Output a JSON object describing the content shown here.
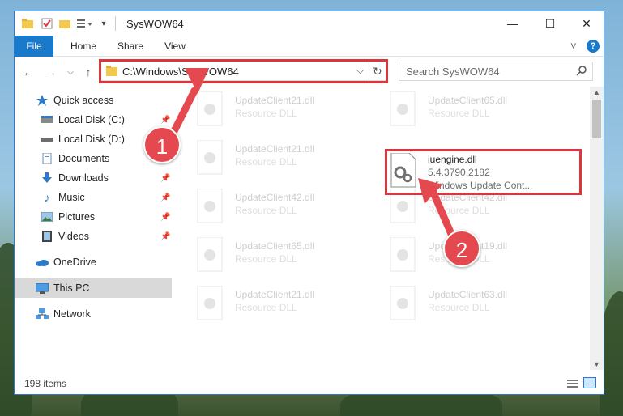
{
  "window": {
    "title": "SysWOW64",
    "minimize_glyph": "—",
    "maximize_glyph": "☐",
    "close_glyph": "✕"
  },
  "ribbon": {
    "tabs": [
      "File",
      "Home",
      "Share",
      "View"
    ],
    "collapse_glyph": "˅",
    "help_glyph": "?"
  },
  "address": {
    "path": "C:\\Windows\\SysWOW64",
    "dropdown_glyph": "⌵",
    "refresh_glyph": "↻"
  },
  "search": {
    "placeholder": "Search SysWOW64"
  },
  "navigation": {
    "back": "←",
    "forward": "→",
    "recent": "⌵",
    "up": "↑"
  },
  "sidebar": {
    "items": [
      {
        "label": "Quick access",
        "icon": "star-icon",
        "pinned": false
      },
      {
        "label": "Local Disk (C:)",
        "icon": "drive-icon",
        "pinned": true
      },
      {
        "label": "Local Disk (D:)",
        "icon": "drive-icon",
        "pinned": true
      },
      {
        "label": "Documents",
        "icon": "documents-icon",
        "pinned": true
      },
      {
        "label": "Downloads",
        "icon": "download-icon",
        "pinned": true
      },
      {
        "label": "Music",
        "icon": "music-icon",
        "pinned": true
      },
      {
        "label": "Pictures",
        "icon": "pictures-icon",
        "pinned": true
      },
      {
        "label": "Videos",
        "icon": "videos-icon",
        "pinned": true
      },
      {
        "label": "OneDrive",
        "icon": "cloud-icon",
        "pinned": false
      },
      {
        "label": "This PC",
        "icon": "computer-icon",
        "pinned": false,
        "selected": true
      },
      {
        "label": "Network",
        "icon": "network-icon",
        "pinned": false
      }
    ]
  },
  "files": {
    "left": [
      {
        "name": "UpdateClient21.dll",
        "type": "Resource DLL"
      },
      {
        "name": "UpdateClient21.dll",
        "type": "Resource DLL"
      },
      {
        "name": "UpdateClient42.dll",
        "type": "Resource DLL"
      },
      {
        "name": "UpdateClient65.dll",
        "type": "Resource DLL"
      },
      {
        "name": "UpdateClient21.dll",
        "type": "Resource DLL"
      }
    ],
    "right": [
      {
        "name": "UpdateClient65.dll",
        "type": "Resource DLL"
      },
      {
        "name": "iuengine.dll",
        "version": "5.4.3790.2182",
        "type": "Windows Update Cont...",
        "highlight": true
      },
      {
        "name": "UpdateClient42.dll",
        "type": "Resource DLL"
      },
      {
        "name": "UpdateClient19.dll",
        "type": "Resource DLL"
      },
      {
        "name": "UpdateClient63.dll",
        "type": "Resource DLL"
      }
    ]
  },
  "status": {
    "item_count": "198 items"
  },
  "callouts": {
    "one": "1",
    "two": "2"
  },
  "colors": {
    "accent": "#1979ca",
    "callout": "#e3494f",
    "highlight_border": "#d9363e"
  }
}
